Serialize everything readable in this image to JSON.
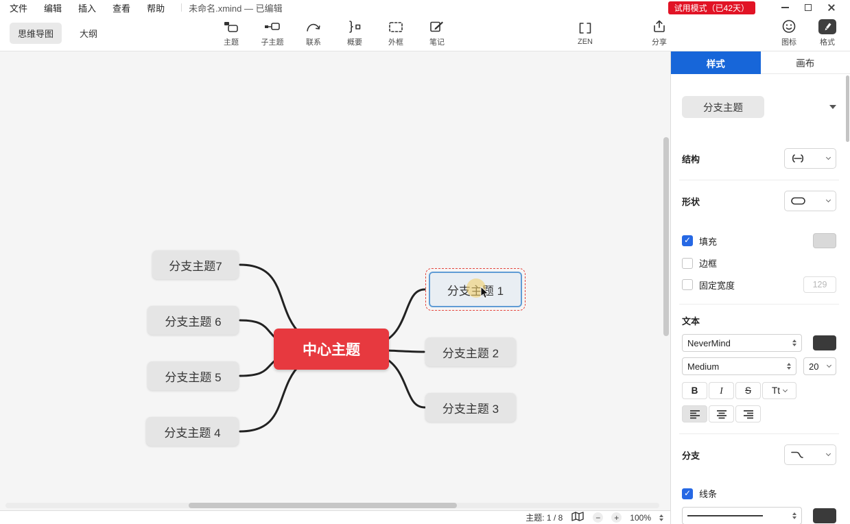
{
  "colors": {
    "accent_blue": "#1766d9",
    "brand_red": "#e7393f",
    "trial_badge_red": "#e11325",
    "checkbox_blue": "#2668e4",
    "selection_border_blue": "#5f9bd5",
    "selection_dash_red": "#e5443c",
    "fill_swatch": "#d9d9d9",
    "text_color_swatch": "#3a3a3a",
    "line_color_swatch": "#3a3a3a"
  },
  "menubar": {
    "menus": [
      {
        "label": "文件"
      },
      {
        "label": "编辑"
      },
      {
        "label": "插入"
      },
      {
        "label": "查看"
      },
      {
        "label": "帮助"
      }
    ],
    "document_title": "未命名.xmind — 已编辑",
    "trial_badge": "试用模式（已42天）"
  },
  "toolbar": {
    "view_tabs": [
      {
        "label": "思维导图",
        "active": true
      },
      {
        "label": "大纲",
        "active": false
      }
    ],
    "tools": [
      {
        "label": "主题",
        "icon": "topic-icon"
      },
      {
        "label": "子主题",
        "icon": "subtopic-icon"
      },
      {
        "label": "联系",
        "icon": "relationship-icon"
      },
      {
        "label": "概要",
        "icon": "summary-icon"
      },
      {
        "label": "外框",
        "icon": "boundary-icon"
      },
      {
        "label": "笔记",
        "icon": "notes-icon"
      }
    ],
    "zen_label": "ZEN",
    "share_label": "分享",
    "stickers_label": "图标",
    "format_label": "格式"
  },
  "mindmap": {
    "central": {
      "label": "中心主题"
    },
    "branches_right": [
      {
        "label": "分支主题 1",
        "selected": true
      },
      {
        "label": "分支主题 2",
        "selected": false
      },
      {
        "label": "分支主题 3",
        "selected": false
      }
    ],
    "branches_left": [
      {
        "label": "分支主题7"
      },
      {
        "label": "分支主题 6"
      },
      {
        "label": "分支主题 5"
      },
      {
        "label": "分支主题 4"
      }
    ]
  },
  "panel": {
    "tabs": [
      {
        "label": "样式",
        "active": true
      },
      {
        "label": "画布",
        "active": false
      }
    ],
    "topic_type_selector": "分支主题",
    "structure": {
      "label": "结构"
    },
    "shape": {
      "label": "形状"
    },
    "fill_checkbox": {
      "label": "填充",
      "checked": true
    },
    "border_checkbox": {
      "label": "边框",
      "checked": false
    },
    "fixed_width_checkbox": {
      "label": "固定宽度",
      "checked": false,
      "value": "129"
    },
    "text_section": {
      "label": "文本",
      "font_family": "NeverMind",
      "font_weight": "Medium",
      "font_size": "20",
      "bold": "B",
      "italic": "I",
      "strike": "S",
      "case_button": "Tt"
    },
    "branch": {
      "label": "分支"
    },
    "line_checkbox": {
      "label": "线条",
      "checked": true
    }
  },
  "statusbar": {
    "topic_counter": "主题: 1 / 8",
    "zoom_level": "100%"
  }
}
